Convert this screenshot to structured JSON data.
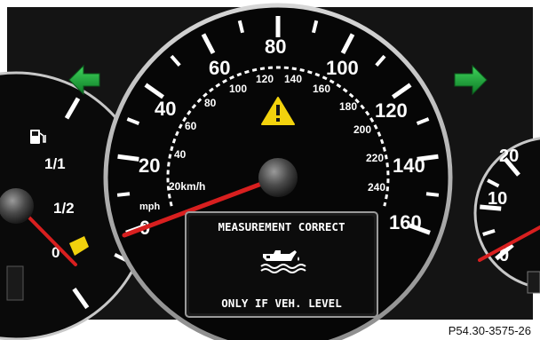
{
  "speedometer": {
    "mph_labels": [
      "20",
      "40",
      "60",
      "80",
      "100",
      "120",
      "140",
      "160"
    ],
    "kmh_labels": [
      "20km/h",
      "40",
      "60",
      "80",
      "100",
      "120",
      "140",
      "160",
      "180",
      "200",
      "220",
      "240"
    ],
    "unit_label": "mph",
    "zero_label": "0"
  },
  "fuel_gauge": {
    "full_label": "1/1",
    "half_label": "1/2",
    "empty_label": "0"
  },
  "tachometer": {
    "labels": [
      "20",
      "10",
      "0"
    ]
  },
  "warning_display": {
    "line1": "MEASUREMENT CORRECT",
    "line2": "ONLY IF VEH. LEVEL",
    "icon": "oil-level-icon"
  },
  "indicators": {
    "left_turn": "left-turn-arrow-icon",
    "right_turn": "right-turn-arrow-icon",
    "warning": "warning-triangle-icon",
    "fuel": "fuel-pump-icon"
  },
  "reference_code": "P54.30-3575-26",
  "colors": {
    "turn_signal": "#1aa33a",
    "needle": "#d81f1f",
    "warning_triangle": "#f2d20d",
    "fuel_reserve": "#f2d20d"
  }
}
